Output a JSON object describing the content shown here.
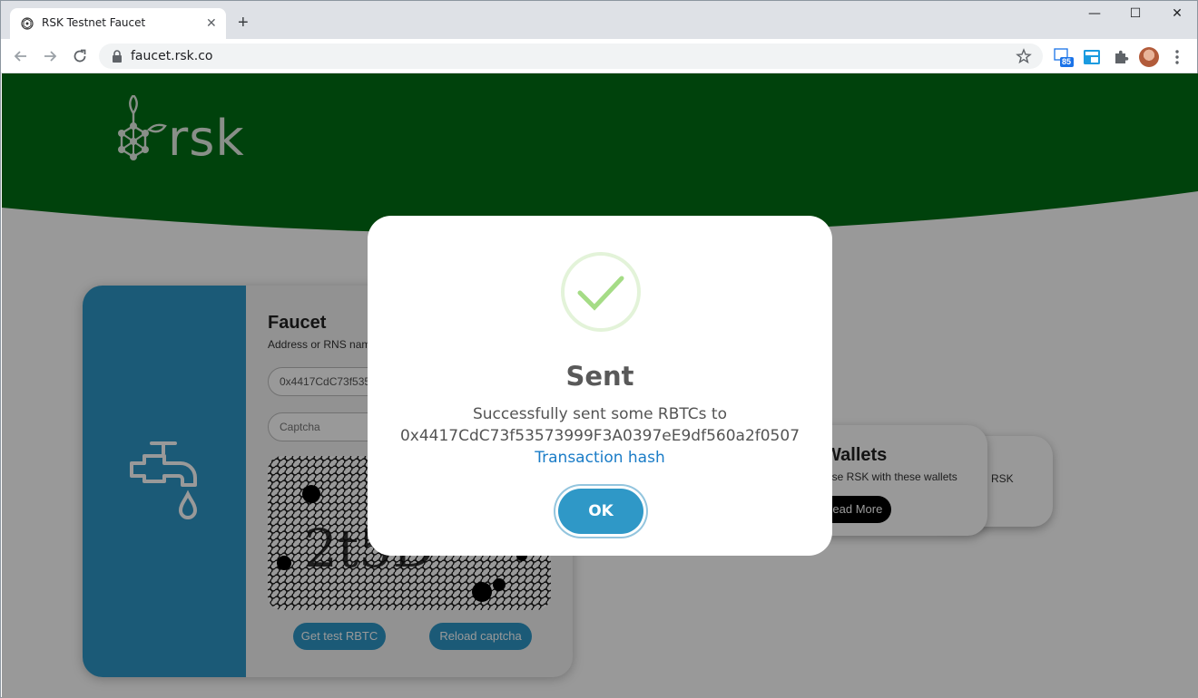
{
  "browser": {
    "tab_title": "RSK Testnet Faucet",
    "tab_close": "✕",
    "new_tab": "+",
    "url": "faucet.rsk.co",
    "extension_badge": "85",
    "window_controls": {
      "minimize": "—",
      "maximize": "☐",
      "close": "✕"
    }
  },
  "header": {
    "logo_text": "rsk",
    "background_color": "#006e14"
  },
  "faucet_card": {
    "title": "Faucet",
    "address_label": "Address or RNS name",
    "address_value": "0x4417CdC73f53573999F3A0397eE9df560a2f0507",
    "captcha_placeholder": "Captcha",
    "get_button": "Get test RBTC",
    "reload_button": "Reload captcha",
    "side_color": "#2e97c6"
  },
  "wallets_card": {
    "title": "Wallets",
    "text": "Use RSK with these wallets",
    "button": "Read More"
  },
  "back_card": {
    "text": "RSK"
  },
  "modal": {
    "title": "Sent",
    "message": "Successfully sent some RBTCs to",
    "address": "0x4417CdC73f53573999F3A0397eE9df560a2f0507",
    "link": "Transaction hash",
    "ok_button": "OK",
    "icon": "checkmark-icon",
    "accent_color": "#a5dc86"
  }
}
